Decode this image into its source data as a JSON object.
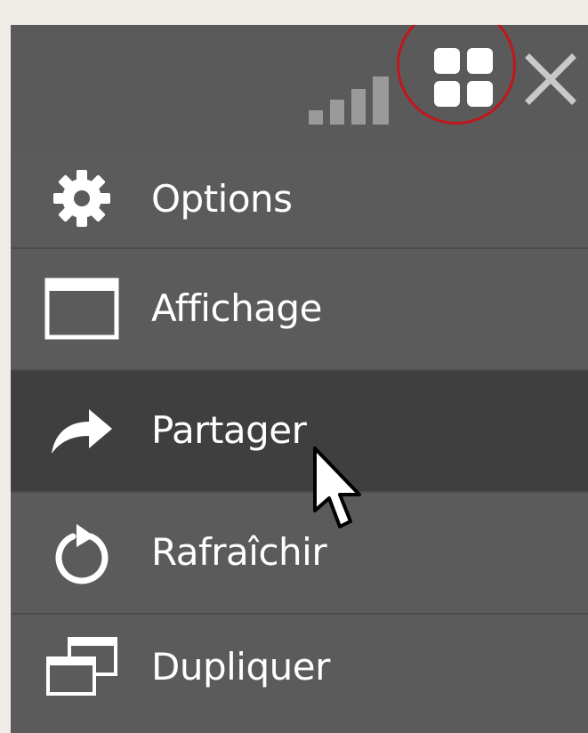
{
  "toolbar": {
    "signal_icon": "signal-bars-icon",
    "tiles_icon": "tiles-icon",
    "close_icon": "close-icon",
    "highlight_color": "#c0161c"
  },
  "menu": {
    "items": [
      {
        "label": "Options",
        "icon": "gear-icon"
      },
      {
        "label": "Affichage",
        "icon": "window-icon"
      },
      {
        "label": "Partager",
        "icon": "share-arrow-icon",
        "hovered": true
      },
      {
        "label": "Rafraîchir",
        "icon": "refresh-icon"
      },
      {
        "label": "Dupliquer",
        "icon": "duplicate-icon"
      }
    ]
  },
  "colors": {
    "panel": "#5b5b5b",
    "hover": "#3f3f3f",
    "text": "#ffffff"
  }
}
